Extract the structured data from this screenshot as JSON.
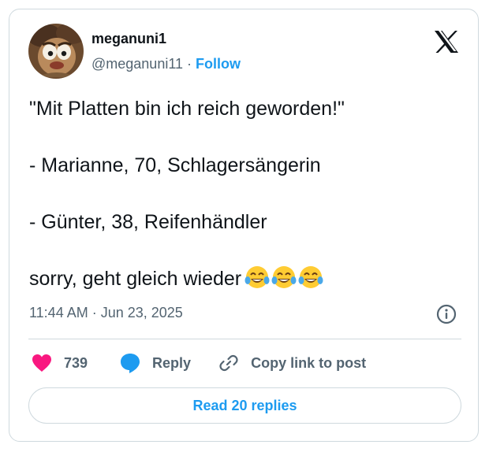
{
  "author": {
    "display_name": "meganuni1",
    "handle": "@meganuni11",
    "separator": "·",
    "follow_label": "Follow",
    "avatar_icon": "muppet-avatar"
  },
  "brand_icon": "x-logo-icon",
  "tweet": {
    "lines": [
      "\"Mit Platten bin ich reich geworden!\"",
      "- Marianne, 70, Schlagersängerin",
      "- Günter, 38, Reifenhändler",
      "sorry, geht gleich wieder"
    ],
    "emojis": [
      "face-with-tears-of-joy",
      "face-with-tears-of-joy",
      "face-with-tears-of-joy"
    ]
  },
  "meta": {
    "timestamp": "11:44 AM · Jun 23, 2025"
  },
  "actions": {
    "like_count": "739",
    "reply_label": "Reply",
    "copy_label": "Copy link to post"
  },
  "read_replies_label": "Read 20 replies",
  "colors": {
    "accent": "#1d9bf0",
    "like": "#f91880",
    "text": "#0f1419",
    "muted": "#536471",
    "border": "#cfd9de"
  }
}
